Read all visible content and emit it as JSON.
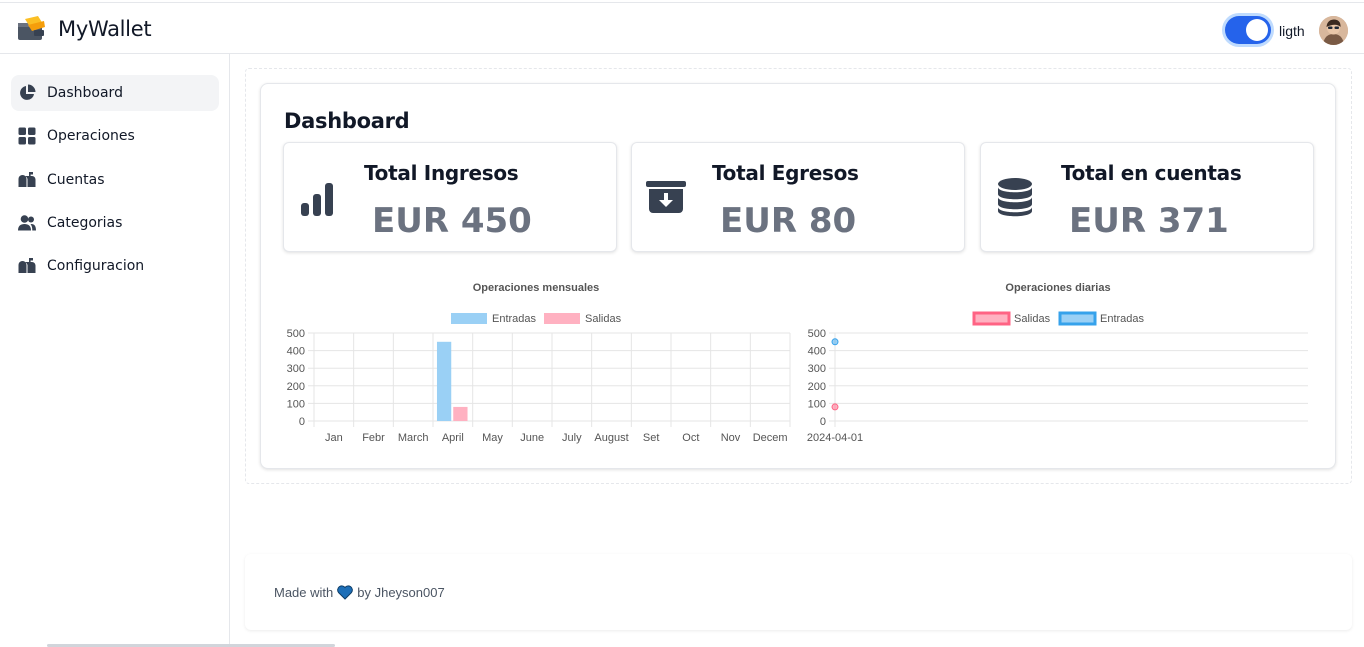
{
  "app": {
    "name": "MyWallet"
  },
  "header": {
    "theme_label": "ligth",
    "theme_on": true
  },
  "sidebar": {
    "items": [
      {
        "label": "Dashboard",
        "icon": "pie-chart-icon",
        "active": true
      },
      {
        "label": "Operaciones",
        "icon": "grid-icon",
        "active": false
      },
      {
        "label": "Cuentas",
        "icon": "mailbox-icon",
        "active": false
      },
      {
        "label": "Categorias",
        "icon": "users-icon",
        "active": false
      },
      {
        "label": "Configuracion",
        "icon": "mailbox-icon",
        "active": false
      }
    ]
  },
  "main": {
    "title": "Dashboard",
    "stats": [
      {
        "label": "Total Ingresos",
        "value": "EUR 450",
        "icon": "bar-chart-icon"
      },
      {
        "label": "Total Egresos",
        "value": "EUR 80",
        "icon": "archive-download-icon"
      },
      {
        "label": "Total en cuentas",
        "value": "EUR 371",
        "icon": "database-icon"
      }
    ]
  },
  "chart_data": [
    {
      "type": "bar",
      "title": "Operaciones mensuales",
      "categories": [
        "Jan",
        "Febr",
        "March",
        "April",
        "May",
        "June",
        "July",
        "August",
        "Set",
        "Oct",
        "Nov",
        "Decem"
      ],
      "series": [
        {
          "name": "Entradas",
          "values": [
            0,
            0,
            0,
            450,
            0,
            0,
            0,
            0,
            0,
            0,
            0,
            0
          ],
          "color": "#9ad0f5"
        },
        {
          "name": "Salidas",
          "values": [
            0,
            0,
            0,
            80,
            0,
            0,
            0,
            0,
            0,
            0,
            0,
            0
          ],
          "color": "#ffb1c1"
        }
      ],
      "ylim": [
        0,
        500
      ],
      "yticks": [
        0,
        100,
        200,
        300,
        400,
        500
      ],
      "grid": true,
      "legend": "top"
    },
    {
      "type": "scatter",
      "title": "Operaciones diarias",
      "categories": [
        "2024-04-01"
      ],
      "series": [
        {
          "name": "Salidas",
          "values": [
            80
          ],
          "color": "#ff6384"
        },
        {
          "name": "Entradas",
          "values": [
            450
          ],
          "color": "#36a2eb"
        }
      ],
      "ylim": [
        0,
        500
      ],
      "yticks": [
        0,
        100,
        200,
        300,
        400,
        500
      ],
      "grid": true,
      "legend": "top"
    }
  ],
  "footer": {
    "prefix": "Made with",
    "suffix": "by Jheyson007"
  },
  "colors": {
    "accent": "#2563eb",
    "heart": "#1d6fb8",
    "icon": "#374151"
  }
}
